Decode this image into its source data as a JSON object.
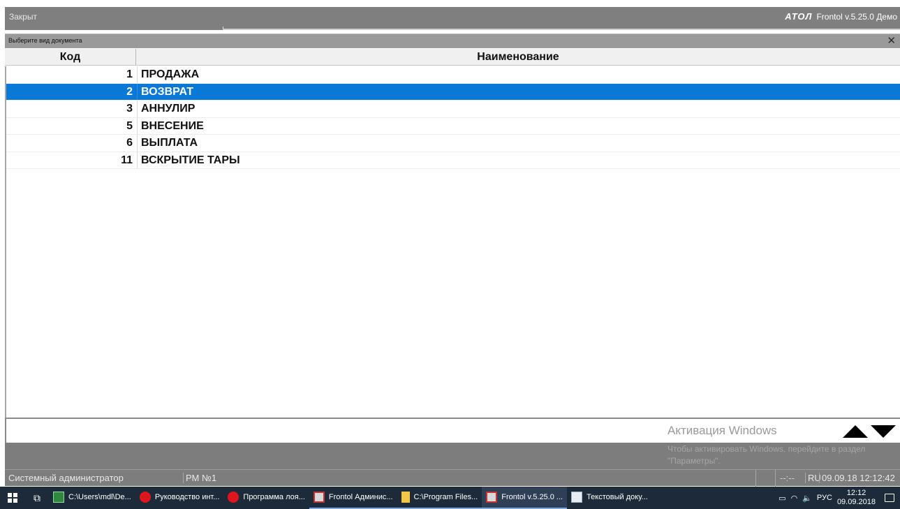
{
  "titlebar": {
    "status": "Закрыт",
    "brand_logo": "ATOЛ",
    "app_version": "Frontol v.5.25.0 Демо"
  },
  "dialog": {
    "caption": "Выберите вид документа",
    "close_glyph": "✕"
  },
  "table": {
    "columns": {
      "code": "Код",
      "name": "Наименование"
    },
    "rows": [
      {
        "code": "1",
        "name": "ПРОДАЖА"
      },
      {
        "code": "2",
        "name": "ВОЗВРАТ"
      },
      {
        "code": "3",
        "name": "АННУЛИР"
      },
      {
        "code": "5",
        "name": "ВНЕСЕНИЕ"
      },
      {
        "code": "6",
        "name": "ВЫПЛАТА"
      },
      {
        "code": "11",
        "name": "ВСКРЫТИЕ ТАРЫ"
      }
    ],
    "selected_index": 1
  },
  "watermark": {
    "title": "Активация Windows",
    "subtitle": "Чтобы активировать Windows, перейдите в раздел \"Параметры\"."
  },
  "status_bar": {
    "user": "Системный администратор",
    "workstation": "РМ №1",
    "dashes": "--:--",
    "language": "RU",
    "datetime": "09.09.18  12:12:42"
  },
  "taskbar": {
    "items": [
      {
        "label": "C:\\Users\\mdl\\De...",
        "icon": "excel-icon"
      },
      {
        "label": "Руководство инт...",
        "icon": "opera-icon"
      },
      {
        "label": "Программа лоя...",
        "icon": "opera-icon"
      },
      {
        "label": "Frontol Админис...",
        "icon": "frontol-icon"
      },
      {
        "label": "C:\\Program Files...",
        "icon": "folder-icon"
      },
      {
        "label": "Frontol v.5.25.0 ...",
        "icon": "frontol-icon"
      },
      {
        "label": "Текстовый доку...",
        "icon": "notepad-icon"
      }
    ],
    "tray": {
      "language": "РУС",
      "time": "12:12",
      "date": "09.09.2018"
    }
  },
  "colors": {
    "selection": "#0a78d7",
    "titlebar": "#7f7f7f",
    "taskbar": "#1d2a3a"
  }
}
